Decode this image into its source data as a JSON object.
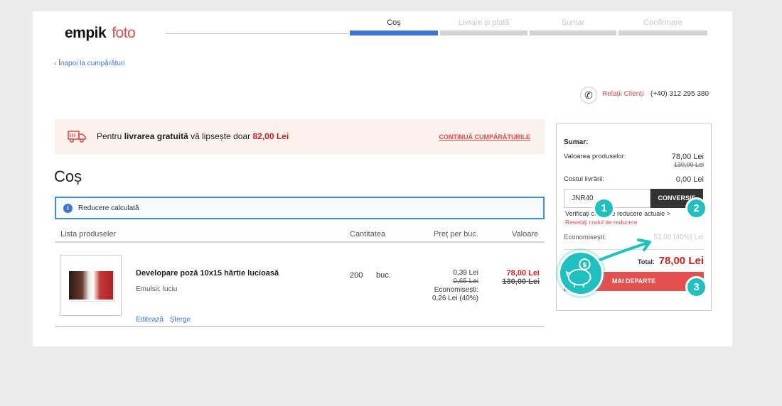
{
  "header": {
    "logo_main": "empik",
    "logo_foto": "foto",
    "steps": [
      {
        "label": "Coș",
        "active": true
      },
      {
        "label": "Livrare și plată",
        "active": false
      },
      {
        "label": "Sumar",
        "active": false
      },
      {
        "label": "Confirmare",
        "active": false
      }
    ],
    "back_link": "‹ Înapoi la cumpărături",
    "contact_label": "Relații Clienți",
    "contact_phone": "(+40) 312 295 380"
  },
  "banner": {
    "prefix": "Pentru ",
    "bold": "livrarea gratuită",
    "middle": " vă lipsește doar ",
    "amount": "82,00 Lei",
    "link": "CONTINUĂ CUMPĂRĂTURILE"
  },
  "page_title": "Coș",
  "discount_notice": "Reducere calculată",
  "table": {
    "headers": {
      "products": "Lista produseler",
      "quantity": "Cantitatea",
      "unit_price": "Preț per buc.",
      "value": "Valoare"
    },
    "items": [
      {
        "name": "Developare poză 10x15 hârtie lucioasă",
        "variant": "Emulsii: luciu",
        "edit": "Editează",
        "delete": "Șterge",
        "qty": "200",
        "unit": "buc.",
        "price": "0,39 Lei",
        "price_old": "0,65 Lei",
        "savings_label": "Economisești:",
        "savings": "0,26 Lei (40%)",
        "value": "78,00 Lei",
        "value_old": "130,00 Lei"
      }
    ]
  },
  "summary": {
    "title": "Sumar:",
    "products_label": "Valoarea produselor:",
    "products_value": "78,00 Lei",
    "products_old": "130,00 Lei",
    "shipping_label": "Costul livrării:",
    "shipping_value": "0,00 Lei",
    "coupon_value": "JNR40",
    "convert_button": "CONVERSIE",
    "verify_text": "Verificați codul de reducere actuale >",
    "reset_text": "Resetați codul de reducere",
    "savings_label": "Economisești:",
    "savings_value": "52,00 (40%) Lei",
    "total_label": "Total:",
    "total_value": "78,00 Lei",
    "next_button": "MAI DEPARTE"
  },
  "annotations": [
    "1",
    "2",
    "3"
  ],
  "colors": {
    "accent_blue": "#3d74d4",
    "brand_red": "#e44b4b",
    "price_red": "#d81e1e",
    "annotation_teal": "#1fc1c0"
  }
}
